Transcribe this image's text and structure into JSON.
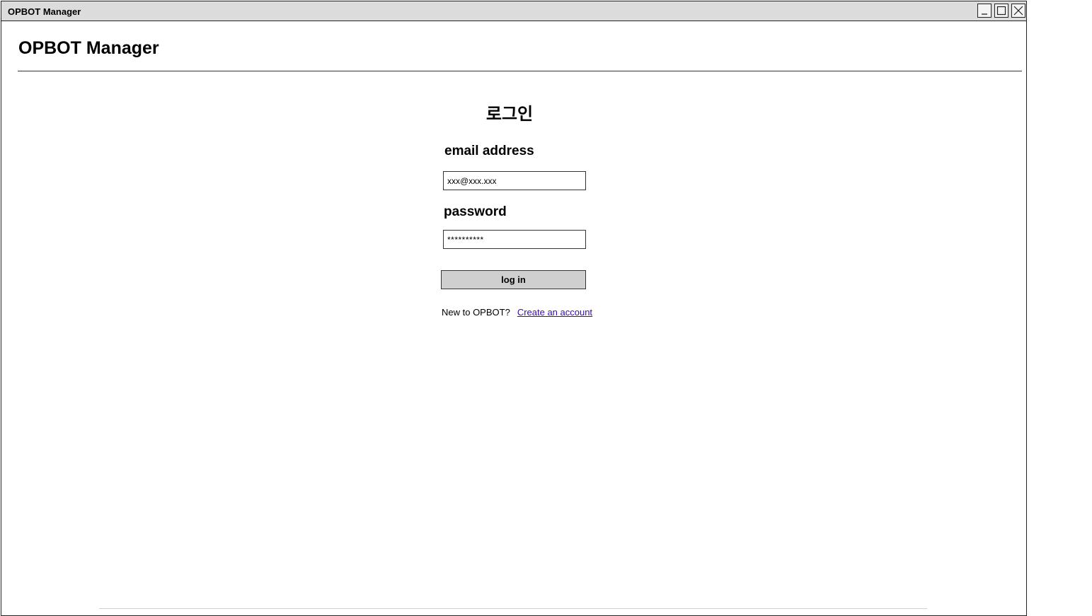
{
  "window": {
    "title": "OPBOT Manager",
    "controls": {
      "minimize_icon": "minimize-icon",
      "maximize_icon": "maximize-icon",
      "close_icon": "close-icon"
    }
  },
  "header": {
    "app_title": "OPBOT Manager"
  },
  "login": {
    "heading": "로그인",
    "email_label": "email address",
    "email_value": "xxx@xxx.xxx",
    "password_label": "password",
    "password_value": "**********",
    "submit_label": "log in",
    "signup_prompt": "New to OPBOT?",
    "signup_link": "Create an account"
  },
  "colors": {
    "titlebar": "#dcdcdc",
    "button": "#cfcfcf",
    "link": "#3a0ca3"
  }
}
